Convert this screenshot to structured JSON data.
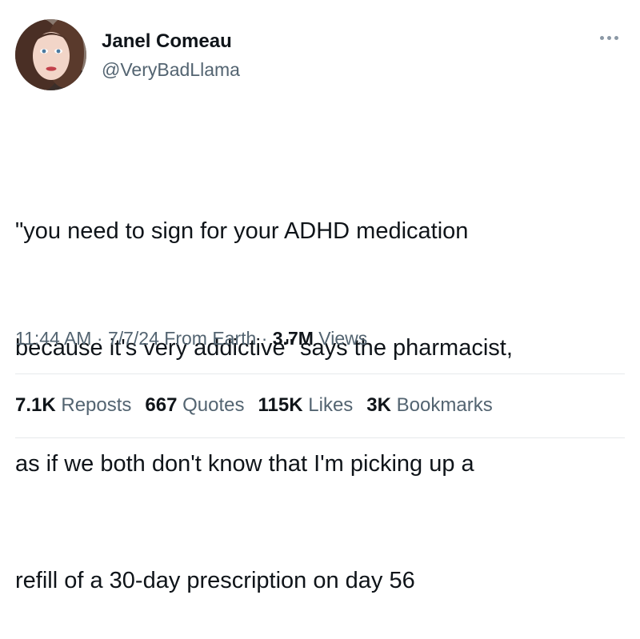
{
  "author": {
    "display_name": "Janel Comeau",
    "handle": "@VeryBadLlama"
  },
  "more_icon": "more-horizontal-icon",
  "tweet": {
    "lines": [
      "\"you need to sign for your ADHD medication",
      "because it's very addictive\" says the pharmacist,",
      "as if we both don't know that I'm picking up a",
      "refill of a 30-day prescription on day 56"
    ]
  },
  "meta": {
    "time": "11:44 AM",
    "date": "7/7/24",
    "source": "From Earth",
    "separator": "·",
    "views_count": "3.7M",
    "views_label": "Views"
  },
  "stats": {
    "reposts": {
      "count": "7.1K",
      "label": "Reposts"
    },
    "quotes": {
      "count": "667",
      "label": "Quotes"
    },
    "likes": {
      "count": "115K",
      "label": "Likes"
    },
    "bookmarks": {
      "count": "3K",
      "label": "Bookmarks"
    }
  },
  "colors": {
    "text_primary": "#0f1419",
    "text_secondary": "#536471",
    "divider": "#e6e9eb"
  }
}
